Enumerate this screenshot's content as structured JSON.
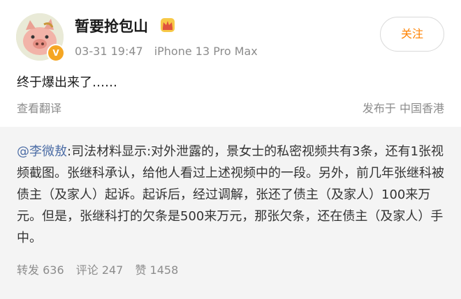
{
  "post": {
    "username": "暂要抢包山",
    "date": "03-31 19:47",
    "device": "iPhone 13 Pro Max",
    "follow_label": "关注",
    "text": "终于爆出来了……",
    "translate_label": "查看翻译",
    "location": "发布于 中国香港",
    "verified_color": "#f5a623",
    "accent_color": "#ff8200"
  },
  "repost": {
    "mention": "@李微敖",
    "body": ":司法材料显示:对外泄露的，景女士的私密视频共有3条，还有1张视频截图。张继科承认，给他人看过上述视频中的一段。另外，前几年张继科被债主（及家人）起诉。起诉后，经过调解，张还了债主（及家人）100来万元。但是，张继科打的欠条是500来万元，那张欠条，还在债主（及家人）手中。",
    "reposts": "转发 636",
    "comments": "评论 247",
    "likes": "赞 1458",
    "mention_color": "#4e6ea6"
  },
  "icons": {
    "avatar": "pig-avatar",
    "badge": "verified-badge-icon",
    "crown": "crown-icon"
  }
}
